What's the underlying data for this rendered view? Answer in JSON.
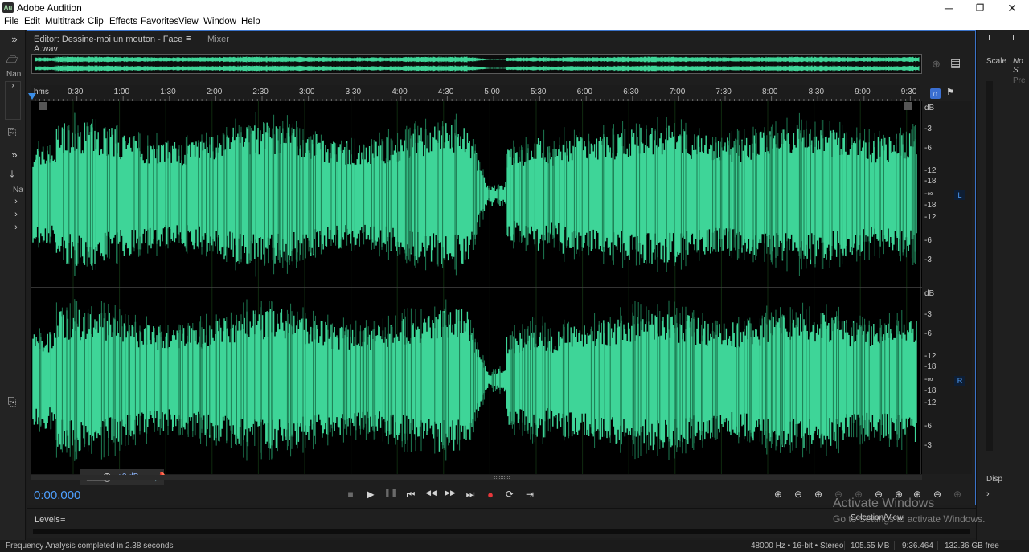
{
  "window": {
    "title": "Adobe Audition",
    "logo_text": "Au",
    "controls": [
      "─",
      "❐",
      "✕"
    ]
  },
  "menu": [
    "File",
    "Edit",
    "Multitrack",
    "Clip",
    "Effects",
    "Favorites",
    "View",
    "Window",
    "Help"
  ],
  "left_dock": {
    "files_label": "Nan",
    "media_label": "Na"
  },
  "editor": {
    "tab_label": "Editor: Dessine-moi un mouton - Face A.wav",
    "tab_menu_icon": "≡",
    "mixer_tab": "Mixer",
    "ruler_unit": "hms",
    "ruler_ticks": [
      "0:30",
      "1:00",
      "1:30",
      "2:00",
      "2:30",
      "3:00",
      "3:30",
      "4:00",
      "4:30",
      "5:00",
      "5:30",
      "6:00",
      "6:30",
      "7:00",
      "7:30",
      "8:00",
      "8:30",
      "9:00",
      "9:30"
    ],
    "db_unit": "dB",
    "db_labels": [
      "-3",
      "-6",
      "-12",
      "-18",
      "-∞",
      "-18",
      "-12",
      "-6",
      "-3"
    ],
    "channel_left": "L",
    "channel_right": "R",
    "hud_volume": "+0 dB",
    "timecode": "0:00.000",
    "waveform_color": "#3ed598"
  },
  "transport": [
    "■",
    "▶",
    "❚❚",
    "⏮",
    "◀◀",
    "▶▶",
    "⏭",
    "●",
    "⟳",
    "⇥"
  ],
  "zoom_icons": [
    "⊕",
    "⊖",
    "⊕",
    "⊖",
    "⊕",
    "⊖",
    "⊕",
    "⊕",
    "⊖",
    "⊕",
    "⊖"
  ],
  "levels": {
    "label": "Levels",
    "menu_icon": "≡"
  },
  "selection_view": "Selection/View",
  "status": {
    "message": "Frequency Analysis completed in 2.38 seconds",
    "format": "48000 Hz • 16-bit • Stereo",
    "size": "105.55 MB",
    "duration": "9:36.464",
    "free": "132.36 GB free"
  },
  "right_dock": {
    "scale_label": "Scale",
    "no_s_label": "No S",
    "pre_label": "Pre",
    "disp_label": "Disp"
  },
  "watermark": {
    "line1": "Activate Windows",
    "line2": "Go to Settings to activate Windows."
  }
}
